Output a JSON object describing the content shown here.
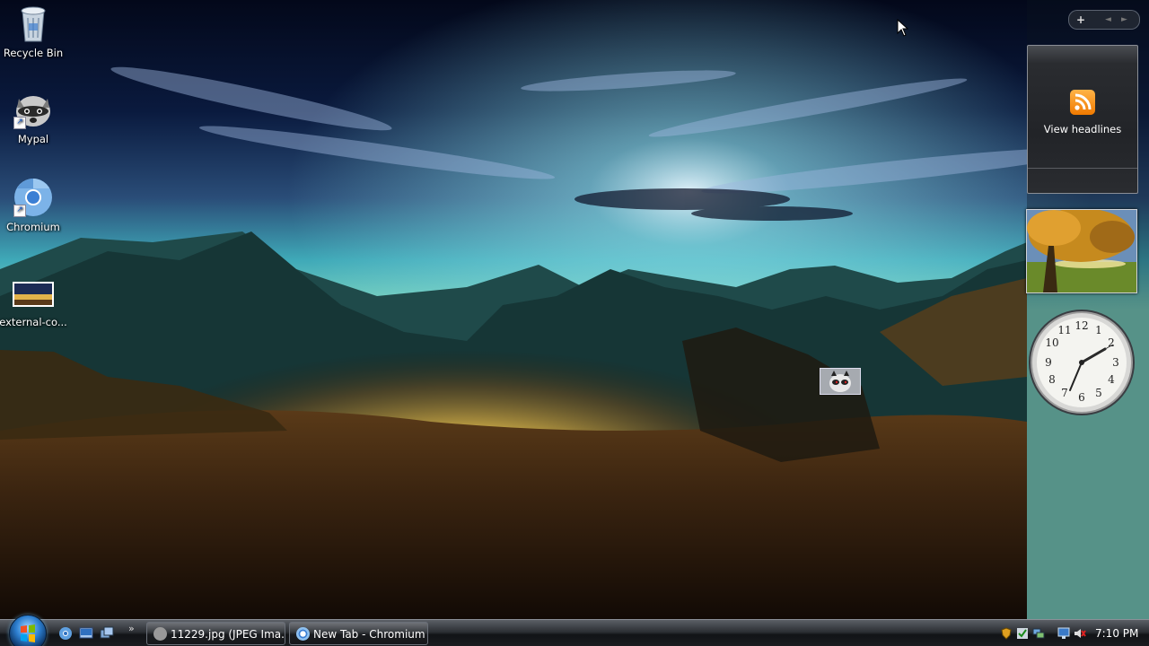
{
  "desktop": {
    "icons": [
      {
        "label": "Recycle Bin"
      },
      {
        "label": "Mypal"
      },
      {
        "label": "Chromium"
      },
      {
        "label": "external-co..."
      }
    ]
  },
  "sidebar": {
    "feed_gadget_text": "View headlines",
    "controls": {
      "add": "+",
      "prev": "◄",
      "next": "►"
    }
  },
  "clock_gadget": {
    "numerals": [
      "12",
      "1",
      "2",
      "3",
      "4",
      "5",
      "6",
      "7",
      "8",
      "9",
      "10",
      "11"
    ]
  },
  "taskbar": {
    "quick_launch_more": "»",
    "buttons": [
      {
        "label": "11229.jpg (JPEG Ima..."
      },
      {
        "label": "New Tab - Chromium"
      }
    ],
    "clock": "7:10 PM"
  },
  "colors": {
    "accent": "#f07a00",
    "taskbar": "#1b1d21"
  }
}
